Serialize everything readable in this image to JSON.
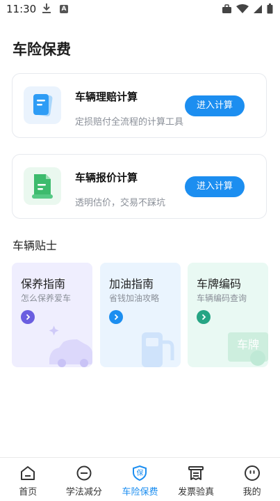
{
  "status_bar": {
    "time": "11:30",
    "a_badge": "A"
  },
  "page": {
    "title": "车险保费"
  },
  "calc_cards": [
    {
      "title": "车辆理赔计算",
      "desc": "定损赔付全流程的计算工具",
      "button": "进入计算",
      "icon": "document-icon"
    },
    {
      "title": "车辆报价计算",
      "desc": "透明估价，交易不踩坑",
      "button": "进入计算",
      "icon": "price-sheet-icon"
    }
  ],
  "tips": {
    "section_title": "车辆贴士",
    "items": [
      {
        "title": "保养指南",
        "subtitle": "怎么保养爱车",
        "bg": "#efeefe",
        "arrow_color": "#6a5ee0",
        "icon": "car-sparkle-icon"
      },
      {
        "title": "加油指南",
        "subtitle": "省钱加油攻略",
        "bg": "#eaf4fe",
        "arrow_color": "#1c8ef0",
        "icon": "fuel-pump-icon"
      },
      {
        "title": "车牌编码",
        "subtitle": "车辆编码查询",
        "bg": "#e9f9f3",
        "arrow_color": "#26a584",
        "icon": "license-plate-icon",
        "deco_text": "车牌"
      }
    ]
  },
  "bottom_nav": [
    {
      "label": "首页",
      "icon": "home-icon",
      "active": false
    },
    {
      "label": "学法减分",
      "icon": "minus-circle-icon",
      "active": false
    },
    {
      "label": "车险保费",
      "icon": "shield-icon",
      "active": true,
      "badge": "保"
    },
    {
      "label": "发票验真",
      "icon": "invoice-icon",
      "active": false
    },
    {
      "label": "我的",
      "icon": "profile-icon",
      "active": false
    }
  ],
  "colors": {
    "accent": "#1c8ef0",
    "purple": "#6a5ee0",
    "teal": "#26a584"
  }
}
